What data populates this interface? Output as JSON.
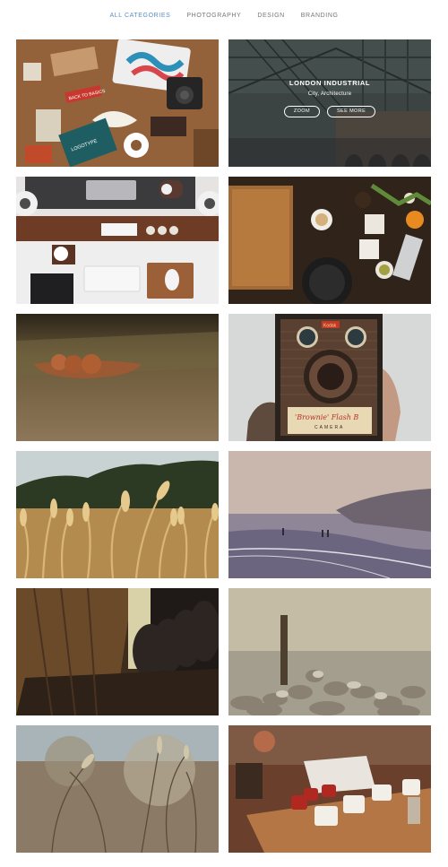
{
  "filters": [
    {
      "label": "ALL CATEGORIES",
      "active": true
    },
    {
      "label": "PHOTOGRAPHY",
      "active": false
    },
    {
      "label": "DESIGN",
      "active": false
    },
    {
      "label": "BRANDING",
      "active": false
    }
  ],
  "featured": {
    "title": "LONDON INDUSTRIAL",
    "subtitle": "City, Architecture",
    "zoom_label": "ZOOM",
    "more_label": "SEE MORE"
  },
  "tiles": [
    {
      "id": "design-flatlay",
      "description": "design studio flatlay"
    },
    {
      "id": "london-industrial",
      "description": "industrial architecture"
    },
    {
      "id": "desk-workspace",
      "description": "desk workspace"
    },
    {
      "id": "kitchen-spices",
      "description": "kitchen spices"
    },
    {
      "id": "wooden-balls",
      "description": "wooden balls"
    },
    {
      "id": "brownie-camera",
      "description": "vintage camera"
    },
    {
      "id": "wheat-field",
      "description": "wheat field"
    },
    {
      "id": "misty-beach",
      "description": "misty beach"
    },
    {
      "id": "cinema-seats",
      "description": "cinema seats"
    },
    {
      "id": "rocky-shore",
      "description": "rocky shore"
    },
    {
      "id": "wild-grass",
      "description": "wild grass"
    },
    {
      "id": "coffee-table",
      "description": "coffee table"
    }
  ],
  "image_text": {
    "camera_brand": "Kodak",
    "camera_model": "'Brownie' Flash B",
    "camera_word": "CAMERA",
    "book_one": "BACK TO BASICS",
    "book_two": "LOGOTYPE"
  },
  "colors": {
    "accent": "#5b8ec7",
    "filter_text": "#777777"
  }
}
